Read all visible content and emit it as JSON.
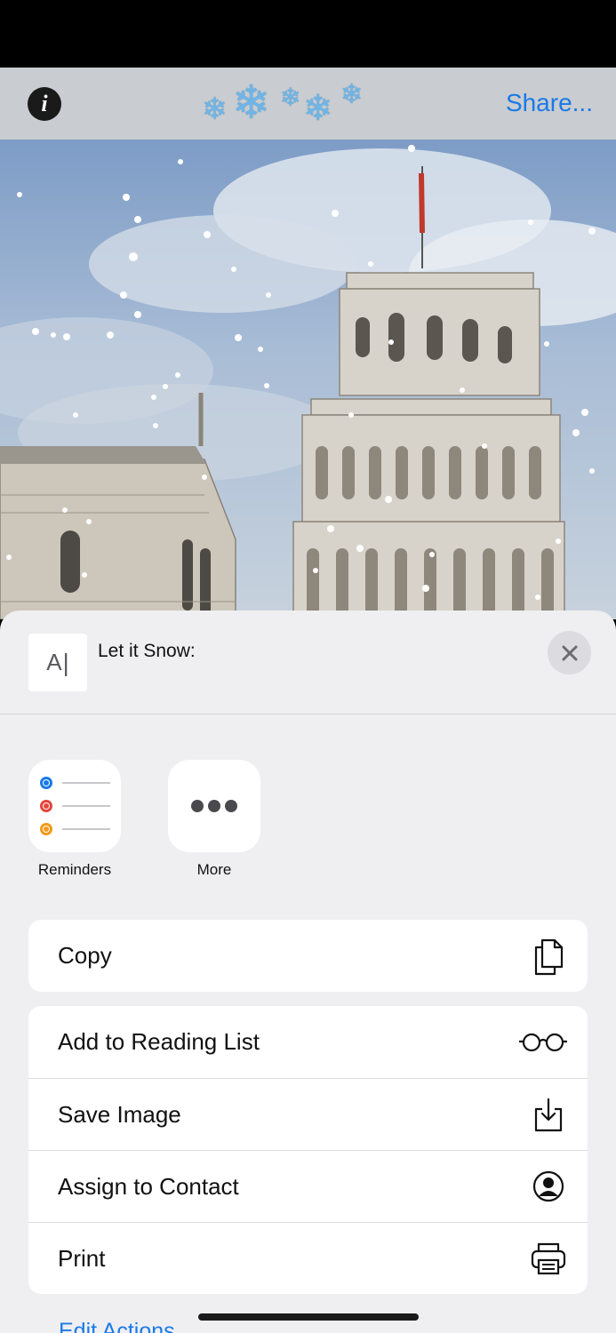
{
  "nav": {
    "info_label": "i",
    "share_label": "Share..."
  },
  "share_sheet": {
    "title": "Let it Snow:",
    "thumb_label": "A",
    "apps": [
      {
        "label": "Reminders",
        "icon": "reminders-icon"
      },
      {
        "label": "More",
        "icon": "more-icon"
      }
    ],
    "actions_group1": [
      {
        "label": "Copy",
        "icon": "copy-icon"
      }
    ],
    "actions_group2": [
      {
        "label": "Add to Reading List",
        "icon": "glasses-icon"
      },
      {
        "label": "Save Image",
        "icon": "save-image-icon"
      },
      {
        "label": "Assign to Contact",
        "icon": "contact-icon"
      },
      {
        "label": "Print",
        "icon": "printer-icon"
      }
    ],
    "edit_actions_label": "Edit Actions..."
  },
  "colors": {
    "accent": "#1a7ae6",
    "reminder_blue": "#1a7ae6",
    "reminder_red": "#e6453a",
    "reminder_orange": "#f29a1a"
  }
}
